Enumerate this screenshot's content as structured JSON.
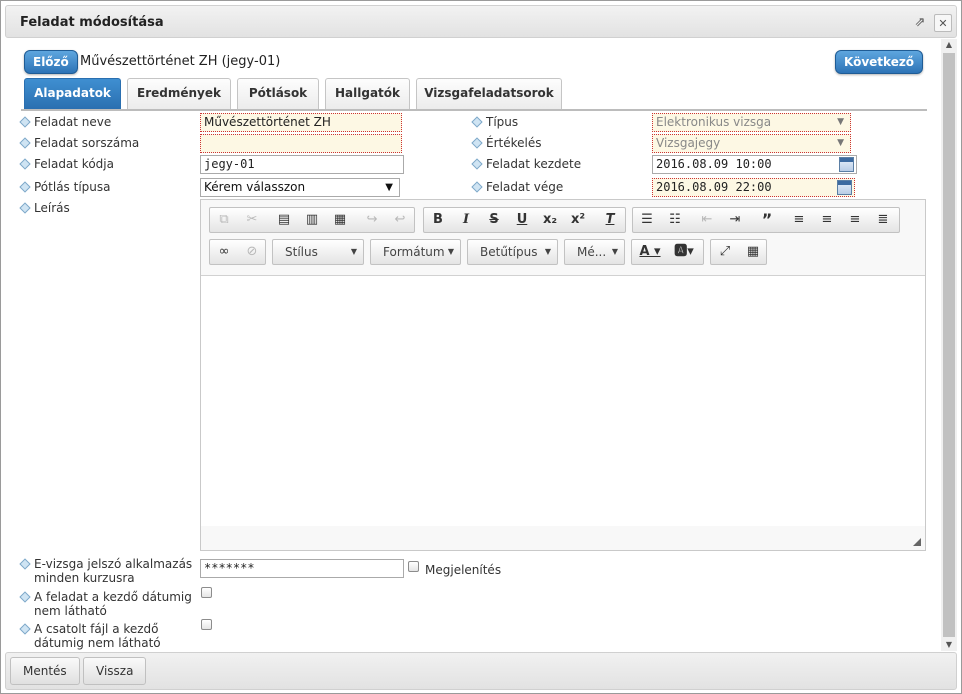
{
  "dialog": {
    "title": "Feladat módosítása"
  },
  "nav": {
    "prev_label": "Előző",
    "next_label": "Következő",
    "task_heading": "Művészettörténet ZH (jegy-01)"
  },
  "tabs": [
    {
      "label": "Alapadatok",
      "active": true
    },
    {
      "label": "Eredmények"
    },
    {
      "label": "Pótlások"
    },
    {
      "label": "Hallgatók"
    },
    {
      "label": "Vizsgafeladatsorok"
    }
  ],
  "form": {
    "task_name": {
      "label": "Feladat neve",
      "value": "Művészettörténet ZH"
    },
    "task_number": {
      "label": "Feladat sorszáma",
      "value": ""
    },
    "task_code": {
      "label": "Feladat kódja",
      "value": "jegy-01"
    },
    "retake_type": {
      "label": "Pótlás típusa",
      "value": "Kérem válasszon"
    },
    "description": {
      "label": "Leírás"
    },
    "type": {
      "label": "Típus",
      "value": "Elektronikus vizsga"
    },
    "evaluation": {
      "label": "Értékelés",
      "value": "Vizsgajegy"
    },
    "start": {
      "label": "Feladat kezdete",
      "value": "2016.08.09 10:00"
    },
    "end": {
      "label": "Feladat vége",
      "value": "2016.08.09 22:00"
    },
    "password": {
      "label": "E-vizsga jelszó alkalmazás minden kurzusra",
      "value": "*******",
      "show_label": "Megjelenítés"
    },
    "hide_until_start": {
      "label": "A feladat a kezdő dátumig nem látható"
    },
    "hide_attachment": {
      "label": "A csatolt fájl a kezdő dátumig nem látható"
    }
  },
  "editor": {
    "style_label": "Stílus",
    "format_label": "Formátum",
    "font_label": "Betűtípus",
    "size_label": "Mé..."
  },
  "footer": {
    "save_label": "Mentés",
    "back_label": "Vissza"
  }
}
